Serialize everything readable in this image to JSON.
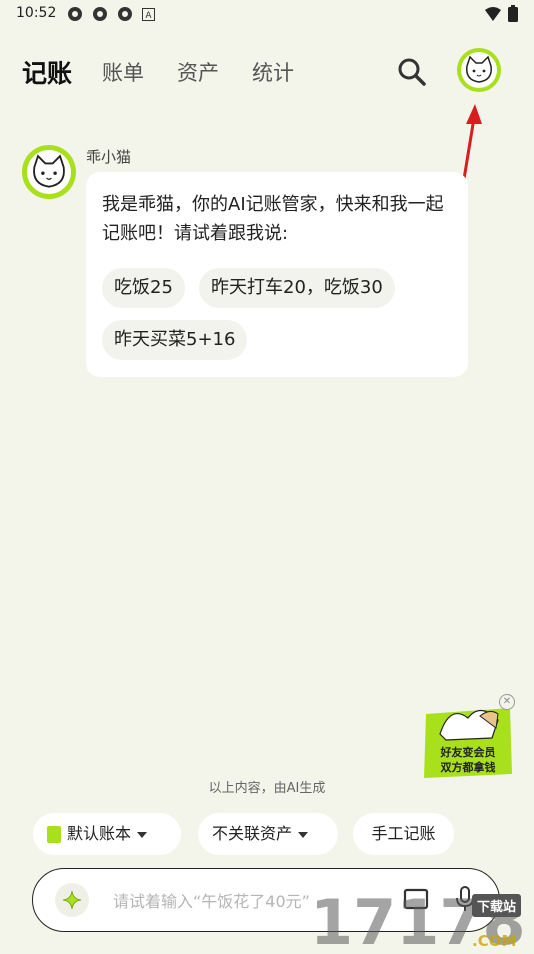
{
  "status_bar": {
    "time": "10:52"
  },
  "nav": {
    "tabs": [
      "记账",
      "账单",
      "资产",
      "统计"
    ],
    "active_tab": "记账"
  },
  "chat": {
    "bot_name": "乖小猫",
    "message": "我是乖猫，你的AI记账管家，快来和我一起记账吧！请试着跟我说:",
    "suggestions": [
      "吃饭25",
      "昨天打车20，吃饭30",
      "昨天买菜5+16"
    ]
  },
  "promo": {
    "line1": "好友变会员",
    "line2": "双方都拿钱"
  },
  "ai_note": "以上内容，由AI生成",
  "options": {
    "book_label": "默认账本",
    "asset_label": "不关联资产",
    "manual_label": "手工记账"
  },
  "input": {
    "placeholder": "请试着输入“午饭花了40元”"
  },
  "watermark": {
    "text": "17178",
    "tag": "下载站",
    "domain": ".COM"
  },
  "colors": {
    "accent": "#a8e01c",
    "background": "#f3f4ea",
    "arrow": "#d81e1e"
  }
}
